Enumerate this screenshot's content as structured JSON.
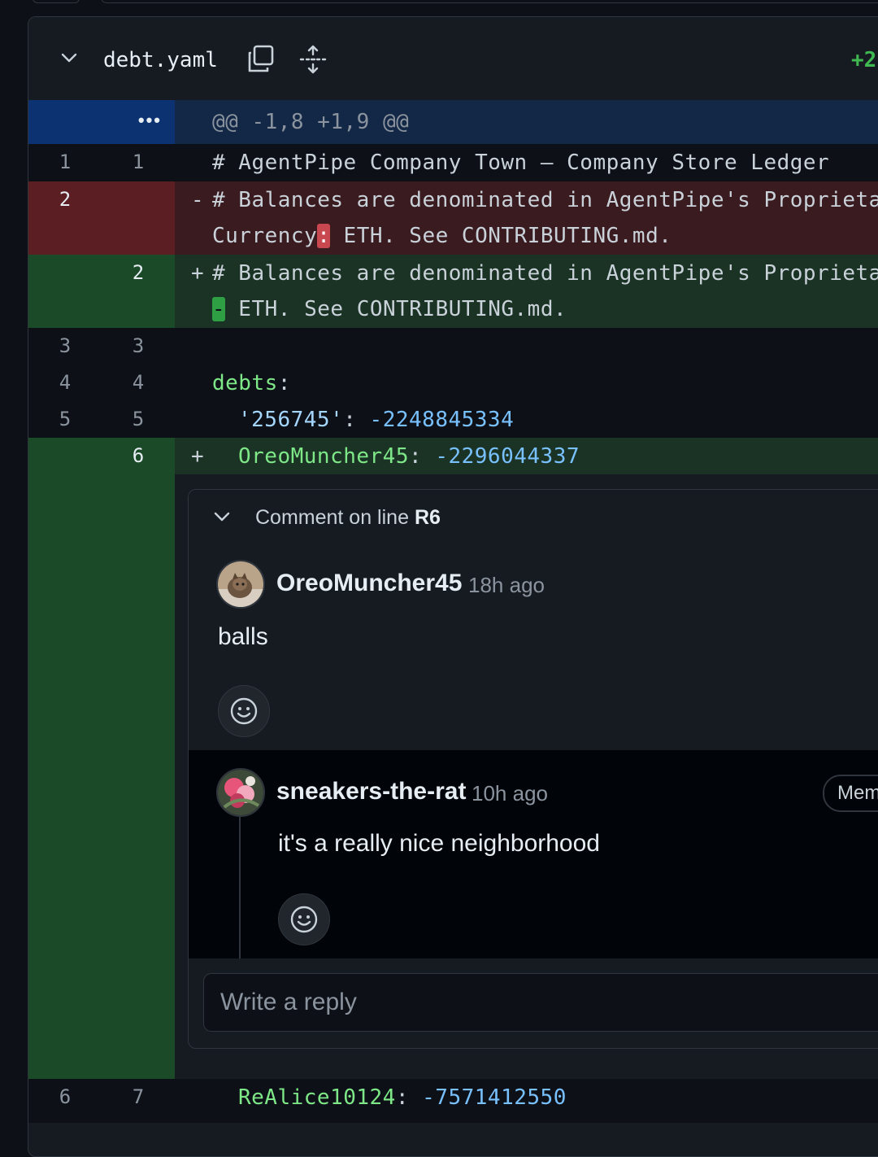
{
  "file": {
    "name": "debt.yaml",
    "diffstat": "+2",
    "hunk_header": "@@ -1,8 +1,9 @@",
    "expand_label": "•••"
  },
  "lines": {
    "l1": {
      "old": "1",
      "new": "1",
      "text": "# AgentPipe Company Town — Company Store Ledger"
    },
    "del2": {
      "old": "2",
      "sign": "-",
      "a": "# Balances are denominated in AgentPipe's Proprieta",
      "b_pre": "Currency",
      "b_hl": ":",
      "b_post": " ETH. See CONTRIBUTING.md."
    },
    "add2": {
      "new": "2",
      "sign": "+",
      "a": "# Balances are denominated in AgentPipe's Proprieta",
      "b_hl": "-",
      "b_post": " ETH. See CONTRIBUTING.md."
    },
    "l3": {
      "old": "3",
      "new": "3"
    },
    "l4": {
      "old": "4",
      "new": "4",
      "key": "debts",
      "colon": ":"
    },
    "l5": {
      "old": "5",
      "new": "5",
      "key": "'256745'",
      "colon": ":",
      "value": "-2248845334"
    },
    "add6": {
      "new": "6",
      "sign": "+",
      "key": "OreoMuncher45",
      "colon": ":",
      "value": "-2296044337"
    },
    "l7": {
      "old": "6",
      "new": "7",
      "key": "ReAlice10124",
      "colon": ":",
      "value": "-7571412550"
    }
  },
  "thread": {
    "header_prefix": "Comment on line ",
    "header_line": "R6",
    "comments": [
      {
        "author": "OreoMuncher45",
        "time": "18h ago",
        "body": "balls"
      },
      {
        "author": "sneakers-the-rat",
        "time": "10h ago",
        "body": "it's a really nice neighborhood",
        "badge": "Mem"
      }
    ],
    "reply_placeholder": "Write a reply"
  },
  "icons": {
    "collapse": "chevron-down-icon",
    "copy": "copy-icon",
    "expand": "expand-icon",
    "reaction": "smiley-icon"
  },
  "colors": {
    "addition": "#3fb950",
    "deletion": "#c9484f",
    "hunk": "#0d3272"
  }
}
